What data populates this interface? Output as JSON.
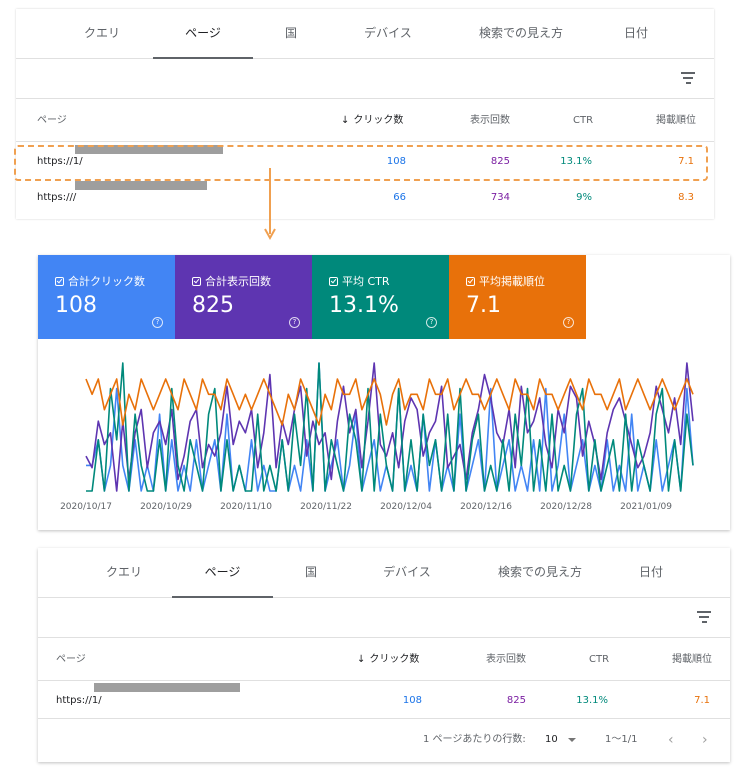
{
  "tabs": [
    "クエリ",
    "ページ",
    "国",
    "デバイス",
    "検索での見え方",
    "日付"
  ],
  "table": {
    "headers": {
      "page": "ページ",
      "clicks": "クリック数",
      "sort_arrow": "↓",
      "impressions": "表示回数",
      "ctr": "CTR",
      "position": "掲載順位"
    },
    "top_rows": [
      {
        "url_prefix": "https://",
        "url_suffix": "1/",
        "clicks": "108",
        "impressions": "825",
        "ctr": "13.1%",
        "position": "7.1"
      },
      {
        "url_prefix": "https://",
        "url_suffix": "/",
        "clicks": "66",
        "impressions": "734",
        "ctr": "9%",
        "position": "8.3"
      }
    ],
    "bottom_row": {
      "url_prefix": "https://",
      "url_suffix": "1/",
      "clicks": "108",
      "impressions": "825",
      "ctr": "13.1%",
      "position": "7.1"
    }
  },
  "cards": [
    {
      "label": "合計クリック数",
      "value": "108",
      "color": "#4285f4"
    },
    {
      "label": "合計表示回数",
      "value": "825",
      "color": "#5e35b1"
    },
    {
      "label": "平均 CTR",
      "value": "13.1%",
      "color": "#00897b"
    },
    {
      "label": "平均掲載順位",
      "value": "7.1",
      "color": "#e8710a"
    }
  ],
  "help_glyph": "?",
  "chart_data": {
    "type": "line",
    "x_tick_labels": [
      "2020/10/17",
      "2020/10/29",
      "2020/11/10",
      "2020/11/22",
      "2020/12/04",
      "2020/12/16",
      "2020/12/28",
      "2021/01/09"
    ],
    "y_axis": "hidden",
    "grid": false,
    "series": [
      {
        "name": "合計クリック数",
        "color": "#4285f4",
        "values": [
          1,
          1,
          2,
          0,
          1,
          4,
          1,
          0,
          2,
          0,
          1,
          0,
          3,
          0,
          2,
          0,
          1,
          0,
          2,
          0,
          1,
          2,
          0,
          3,
          0,
          1,
          0,
          2,
          0,
          1,
          0,
          0,
          2,
          0,
          1,
          0,
          2,
          0,
          5,
          0,
          1,
          2,
          0,
          1,
          3,
          0,
          1,
          2,
          0,
          1,
          0,
          4,
          0,
          1,
          0,
          3,
          0,
          2,
          0,
          1,
          0,
          3,
          0,
          1,
          2,
          0,
          4,
          0,
          1,
          2,
          0,
          1,
          0,
          2,
          0,
          4,
          0,
          1,
          3,
          0,
          1,
          2,
          0,
          1,
          0,
          2,
          0,
          1,
          0,
          3,
          0,
          1,
          0,
          2,
          0,
          1,
          2,
          0,
          4,
          1
        ]
      },
      {
        "name": "合計表示回数",
        "color": "#5e35b1",
        "values": [
          6,
          5,
          9,
          7,
          8,
          3,
          9,
          4,
          8,
          10,
          5,
          8,
          9,
          7,
          10,
          4,
          6,
          9,
          10,
          5,
          7,
          6,
          8,
          12,
          7,
          9,
          8,
          10,
          5,
          8,
          13,
          5,
          9,
          7,
          10,
          12,
          6,
          9,
          7,
          8,
          4,
          9,
          12,
          8,
          10,
          5,
          9,
          14,
          7,
          6,
          8,
          5,
          9,
          11,
          10,
          6,
          8,
          9,
          12,
          5,
          6,
          7,
          4,
          8,
          10,
          13,
          11,
          8,
          7,
          10,
          5,
          12,
          8,
          9,
          11,
          7,
          5,
          10,
          8,
          12,
          11,
          6,
          9,
          7,
          4,
          8,
          10,
          11,
          9,
          7,
          5,
          6,
          8,
          12,
          10,
          8,
          11,
          7,
          14,
          9
        ]
      },
      {
        "name": "平均 CTR",
        "color": "#00897b",
        "values": [
          0,
          0,
          2,
          0,
          4,
          2,
          5,
          0,
          3,
          1,
          0,
          0,
          2,
          0,
          4,
          1,
          0,
          2,
          1,
          0,
          3,
          4,
          0,
          2,
          0,
          1,
          0,
          0,
          3,
          0,
          1,
          0,
          2,
          0,
          3,
          1,
          4,
          0,
          5,
          0,
          2,
          1,
          0,
          3,
          2,
          0,
          4,
          0,
          3,
          1,
          0,
          4,
          0,
          2,
          0,
          3,
          1,
          2,
          0,
          3,
          0,
          4,
          0,
          2,
          3,
          0,
          1,
          0,
          2,
          0,
          3,
          1,
          4,
          0,
          2,
          0,
          3,
          0,
          1,
          0,
          3,
          4,
          0,
          2,
          0,
          1,
          2,
          0,
          3,
          0,
          2,
          1,
          0,
          3,
          4,
          0,
          2,
          0,
          3,
          1
        ]
      },
      {
        "name": "平均掲載順位",
        "color": "#e8710a",
        "values": [
          8,
          7,
          8,
          6,
          7,
          8,
          5,
          7,
          6,
          8,
          7,
          6,
          7,
          8,
          7,
          6,
          8,
          7,
          6,
          8,
          7,
          7,
          6,
          8,
          7,
          6,
          7,
          6,
          7,
          8,
          7,
          6,
          5,
          7,
          6,
          8,
          7,
          6,
          5,
          7,
          6,
          8,
          7,
          7,
          8,
          6,
          7,
          8,
          7,
          5,
          7,
          8,
          6,
          7,
          7,
          6,
          8,
          7,
          7,
          8,
          6,
          7,
          8,
          7,
          7,
          6,
          7,
          8,
          7,
          6,
          8,
          7,
          7,
          6,
          8,
          7,
          7,
          6,
          7,
          8,
          7,
          6,
          8,
          7,
          7,
          6,
          7,
          8,
          6,
          7,
          8,
          7,
          6,
          7,
          8,
          7,
          6,
          7,
          8,
          7
        ]
      }
    ]
  },
  "pagination": {
    "rows_label": "1 ページあたりの行数:",
    "rows_value": "10",
    "range": "1〜1/1",
    "prev_icon": "‹",
    "next_icon": "›"
  }
}
